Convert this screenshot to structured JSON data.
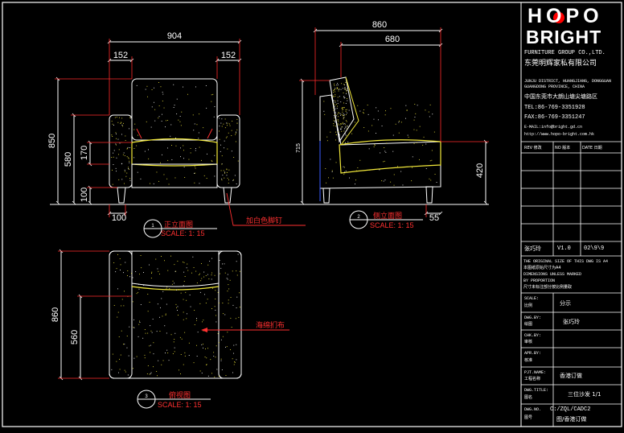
{
  "front_view": {
    "dims": {
      "overall_width": "904",
      "arm_left": "152",
      "arm_right": "152",
      "overall_height": "850",
      "arm_height": "580",
      "seat_thickness": "170",
      "leg_height": "100",
      "leg_offset": "100"
    },
    "title": "正立面图",
    "scale": "SCALE: 1: 15",
    "callout": "加白色脚钉"
  },
  "side_view": {
    "dims": {
      "overall_depth": "860",
      "seat_depth": "680",
      "back_height": "715",
      "arm_height": "420",
      "leg_offset": "55"
    },
    "title": "侧立面图",
    "scale": "SCALE: 1: 15"
  },
  "top_view": {
    "dims": {
      "overall_depth": "860",
      "seat_depth": "560"
    },
    "title": "俯视图",
    "scale": "SCALE: 1: 15",
    "callout": "海绵扪布"
  },
  "title_block": {
    "logo_line1": "HOPO",
    "logo_line2": "BRIGHT",
    "company_en": "FURNITURE GROUP CO.,LTD.",
    "company_cn": "东莞明辉家私有限公司",
    "address_en_1": "JUNJU DISTRICT, HUANGJIANG, DONGGUAN",
    "address_en_2": "GUANGDONG PROVINCE, CHINA",
    "address_cn": "中国东莞市大朗山塘尖塘路区",
    "tel": "TEL:86-769-3351928",
    "fax": "FAX:86-769-3351247",
    "email": "E-MAIL:info@bright.gd.cn",
    "http": "http://www.hopo-bright.com.hk",
    "rev_header": {
      "rev": "REV 修改",
      "no": "NO 版本",
      "date": "DATE 日期"
    },
    "revision_row": {
      "name": "张巧玲",
      "version": "V1.0",
      "date": "02\\9\\9"
    },
    "notice": [
      "THE ORIGINAL SIZE OF THIS DWG IS A4",
      "本图纸原始尺寸为A4",
      "DIMENSIONS UNLESS MARKED",
      "BY PROPORTION",
      "尺寸未标注部分按比例量取"
    ],
    "scale_label_en": "SCALE:",
    "scale_label_cn": "比例",
    "scale_value": "分示",
    "dwg_by_en": "DWG.BY:",
    "dwg_by_cn": "绘图",
    "dwg_by_value": "张巧玲",
    "chk_by_en": "CHK.BY:",
    "chk_by_cn": "审核",
    "apr_by_en": "APR.BY:",
    "apr_by_cn": "核准",
    "pjt_name_en": "PJT.NAME:",
    "pjt_name_cn": "工程名称",
    "pjt_name_value": "香港订做",
    "dwg_title_en": "DWG.TITLE:",
    "dwg_title_cn": "图名",
    "dwg_title_value": "三位沙发 1/1",
    "dwg_no_en": "DWG.NO.",
    "dwg_no_cn": "图号",
    "dwg_no_value_1": "C:/ZQL/CADC2",
    "dwg_no_value_2": "图/香港订做"
  },
  "colors": {
    "background": "#000000",
    "border": "#ffffff",
    "dimension": "#ffffff",
    "extension": "#ff2a2a",
    "cushion": "#f2e83a",
    "callout": "#ff3030",
    "logo_dot": "#ff0000"
  }
}
